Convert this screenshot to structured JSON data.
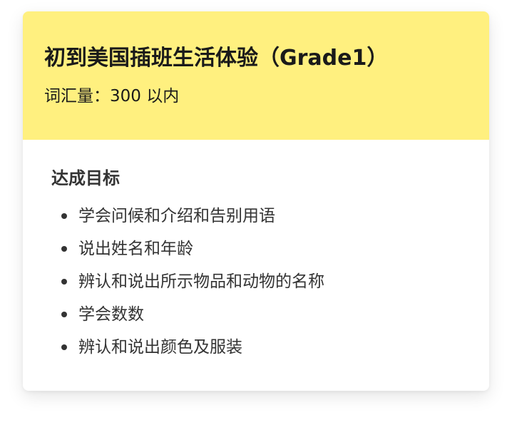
{
  "card": {
    "title": "初到美国插班生活体验（Grade1）",
    "subtitle": "词汇量：300 以内"
  },
  "goals": {
    "heading": "达成目标",
    "items": [
      "学会问候和介绍和告别用语",
      "说出姓名和年龄",
      "辨认和说出所示物品和动物的名称",
      "学会数数",
      "辨认和说出颜色及服装"
    ]
  },
  "colors": {
    "header_background": "#fff07f",
    "text_primary": "#1a1a1a",
    "text_body": "#333333"
  }
}
